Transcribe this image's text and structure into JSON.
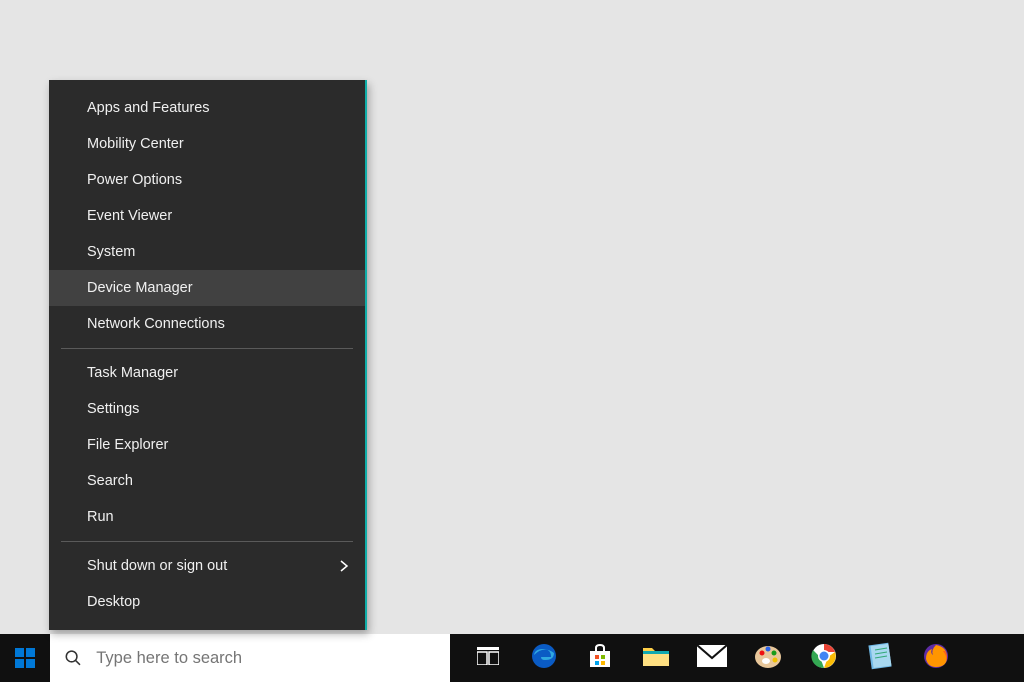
{
  "context_menu": {
    "items": [
      {
        "label": "Apps and Features",
        "name": "menu-apps-features"
      },
      {
        "label": "Mobility Center",
        "name": "menu-mobility-center"
      },
      {
        "label": "Power Options",
        "name": "menu-power-options"
      },
      {
        "label": "Event Viewer",
        "name": "menu-event-viewer"
      },
      {
        "label": "System",
        "name": "menu-system"
      },
      {
        "label": "Device Manager",
        "name": "menu-device-manager",
        "hovered": true
      },
      {
        "label": "Network Connections",
        "name": "menu-network-connections"
      },
      {
        "separator": true
      },
      {
        "label": "Task Manager",
        "name": "menu-task-manager"
      },
      {
        "label": "Settings",
        "name": "menu-settings"
      },
      {
        "label": "File Explorer",
        "name": "menu-file-explorer"
      },
      {
        "label": "Search",
        "name": "menu-search"
      },
      {
        "label": "Run",
        "name": "menu-run"
      },
      {
        "separator": true
      },
      {
        "label": "Shut down or sign out",
        "name": "menu-shutdown",
        "submenu": true
      },
      {
        "label": "Desktop",
        "name": "menu-desktop"
      }
    ]
  },
  "taskbar": {
    "search_placeholder": "Type here to search",
    "icons": [
      {
        "name": "task-view-icon"
      },
      {
        "name": "edge-icon"
      },
      {
        "name": "store-icon"
      },
      {
        "name": "file-explorer-icon"
      },
      {
        "name": "mail-icon"
      },
      {
        "name": "paint-icon"
      },
      {
        "name": "chrome-icon"
      },
      {
        "name": "notepad-icon"
      },
      {
        "name": "firefox-icon"
      }
    ]
  }
}
